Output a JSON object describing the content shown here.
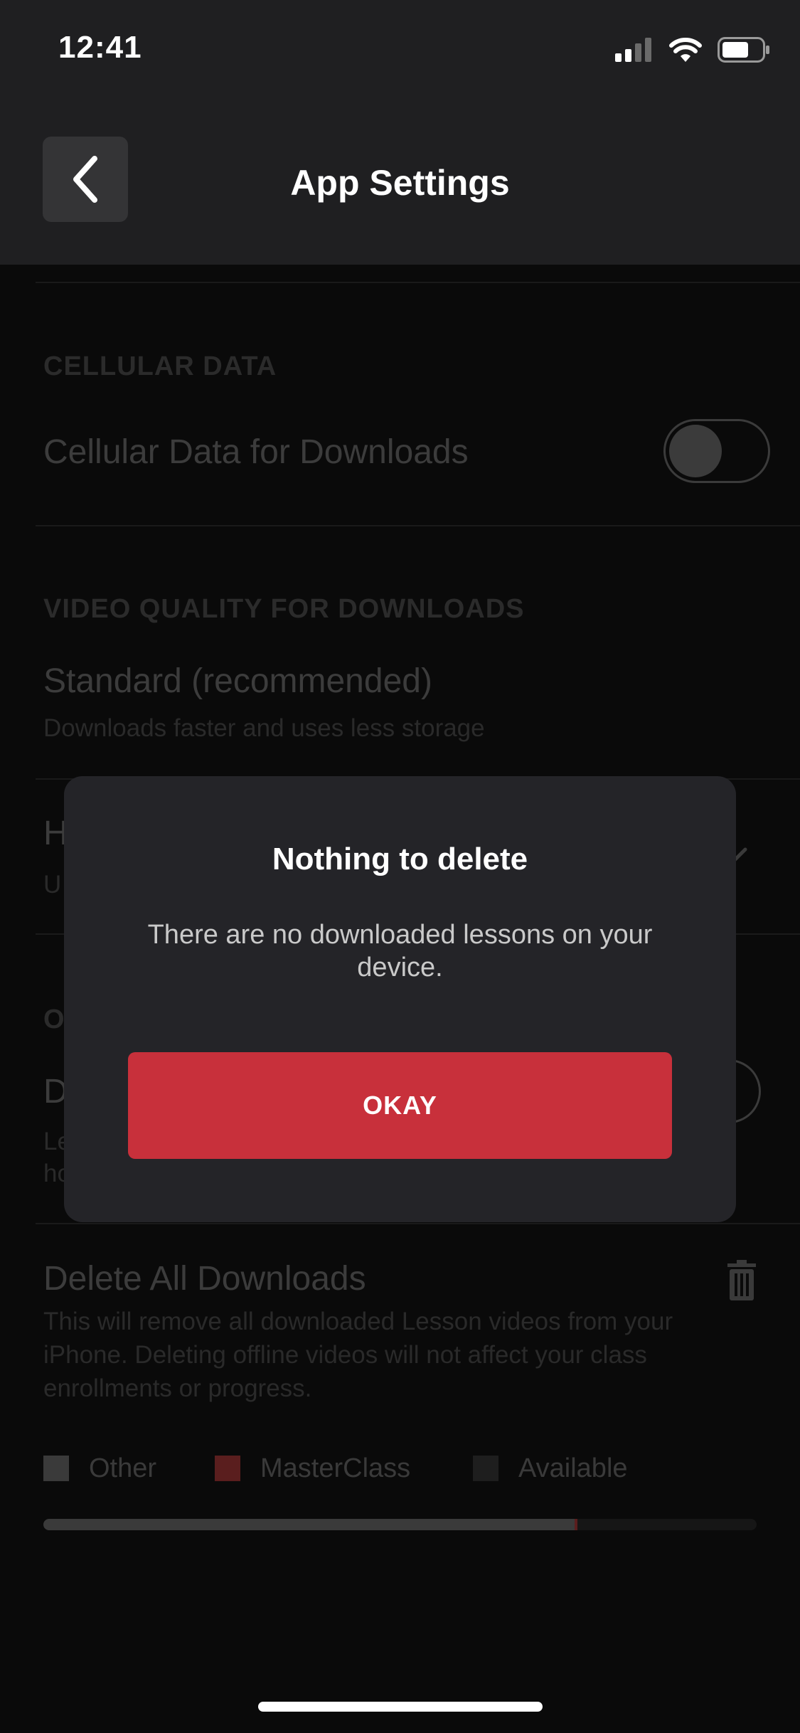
{
  "status_bar": {
    "time": "12:41"
  },
  "navbar": {
    "title": "App Settings"
  },
  "cellular": {
    "header": "CELLULAR DATA",
    "row_label": "Cellular Data for Downloads",
    "toggle_on": false
  },
  "video_quality": {
    "header": "VIDEO QUALITY FOR DOWNLOADS",
    "standard_label": "Standard (recommended)",
    "standard_sub": "Downloads faster and uses less storage",
    "hd_label_partial": "H",
    "hd_sub_partial": "U"
  },
  "other_section": {
    "header_partial": "O",
    "row_label_partial": "D",
    "row_sub_partial_1": "Le",
    "row_sub_partial_2": "ho"
  },
  "delete_all": {
    "label": "Delete All Downloads",
    "description": "This will remove all downloaded Lesson videos from your iPhone. Deleting offline videos will not affect your class enrollments or progress."
  },
  "storage_legend": [
    {
      "label": "Other",
      "color": "#3a3a3a"
    },
    {
      "label": "MasterClass",
      "color": "#5a1e1e"
    },
    {
      "label": "Available",
      "color": "#1e1e1e"
    }
  ],
  "storage_usage": {
    "other_fraction": 0.745,
    "masterclass_fraction": 0.004
  },
  "dialog": {
    "title": "Nothing to delete",
    "message": "There are no downloaded lessons on your device.",
    "button_label": "OKAY"
  },
  "colors": {
    "accent": "#c8303b",
    "dialog_bg": "#242428",
    "nav_bg": "#1f1f21"
  },
  "icons": [
    "back-chevron-icon",
    "cellular-signal-icon",
    "wifi-icon",
    "battery-icon",
    "trash-icon",
    "checkmark-icon"
  ]
}
